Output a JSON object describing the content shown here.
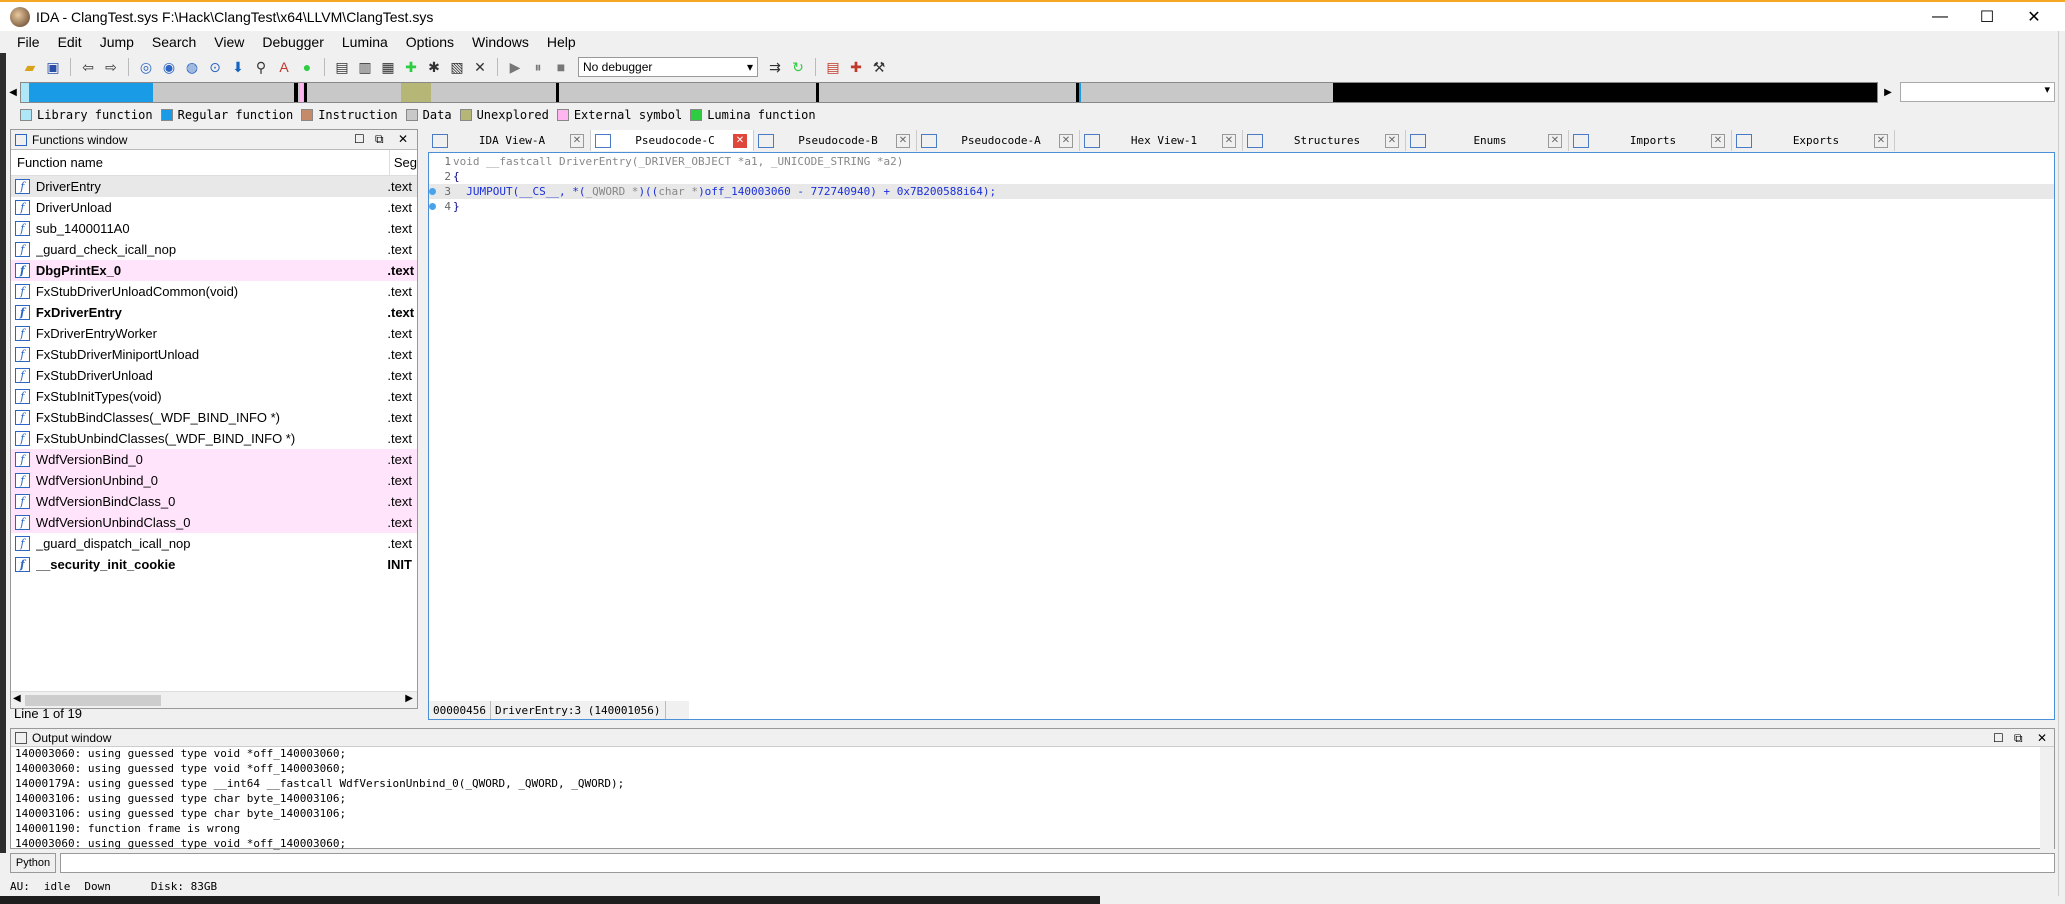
{
  "window": {
    "title": "IDA - ClangTest.sys F:\\Hack\\ClangTest\\x64\\LLVM\\ClangTest.sys",
    "minimize": "—",
    "maximize": "☐",
    "close": "✕"
  },
  "menu": [
    "File",
    "Edit",
    "Jump",
    "Search",
    "View",
    "Debugger",
    "Lumina",
    "Options",
    "Windows",
    "Help"
  ],
  "toolbar": {
    "debugger": "No debugger"
  },
  "legend": [
    {
      "label": "Library function",
      "color": "#aee8f8"
    },
    {
      "label": "Regular function",
      "color": "#1a9be6"
    },
    {
      "label": "Instruction",
      "color": "#c48a6a"
    },
    {
      "label": "Data",
      "color": "#c8c8c8"
    },
    {
      "label": "Unexplored",
      "color": "#b6b676"
    },
    {
      "label": "External symbol",
      "color": "#ffb6f0"
    },
    {
      "label": "Lumina function",
      "color": "#2ecc40"
    }
  ],
  "functions": {
    "title": "Functions window",
    "col_name": "Function name",
    "col_seg": "Seg",
    "rows": [
      {
        "name": "DriverEntry",
        "seg": ".text",
        "style": "sel"
      },
      {
        "name": "DriverUnload",
        "seg": ".text",
        "style": ""
      },
      {
        "name": "sub_1400011A0",
        "seg": ".text",
        "style": ""
      },
      {
        "name": "_guard_check_icall_nop",
        "seg": ".text",
        "style": ""
      },
      {
        "name": "DbgPrintEx_0",
        "seg": ".text",
        "style": "pink bold"
      },
      {
        "name": "FxStubDriverUnloadCommon(void)",
        "seg": ".text",
        "style": ""
      },
      {
        "name": "FxDriverEntry",
        "seg": ".text",
        "style": "bold"
      },
      {
        "name": "FxDriverEntryWorker",
        "seg": ".text",
        "style": ""
      },
      {
        "name": "FxStubDriverMiniportUnload",
        "seg": ".text",
        "style": ""
      },
      {
        "name": "FxStubDriverUnload",
        "seg": ".text",
        "style": ""
      },
      {
        "name": "FxStubInitTypes(void)",
        "seg": ".text",
        "style": ""
      },
      {
        "name": "FxStubBindClasses(_WDF_BIND_INFO *)",
        "seg": ".text",
        "style": ""
      },
      {
        "name": "FxStubUnbindClasses(_WDF_BIND_INFO *)",
        "seg": ".text",
        "style": ""
      },
      {
        "name": "WdfVersionBind_0",
        "seg": ".text",
        "style": "pink"
      },
      {
        "name": "WdfVersionUnbind_0",
        "seg": ".text",
        "style": "pink"
      },
      {
        "name": "WdfVersionBindClass_0",
        "seg": ".text",
        "style": "pink"
      },
      {
        "name": "WdfVersionUnbindClass_0",
        "seg": ".text",
        "style": "pink"
      },
      {
        "name": "_guard_dispatch_icall_nop",
        "seg": ".text",
        "style": ""
      },
      {
        "name": "__security_init_cookie",
        "seg": "INIT",
        "style": "bold"
      }
    ],
    "status": "Line 1 of 19"
  },
  "tabs": [
    {
      "label": "IDA View-A",
      "active": false
    },
    {
      "label": "Pseudocode-C",
      "active": true
    },
    {
      "label": "Pseudocode-B",
      "active": false
    },
    {
      "label": "Pseudocode-A",
      "active": false
    },
    {
      "label": "Hex View-1",
      "active": false
    },
    {
      "label": "Structures",
      "active": false
    },
    {
      "label": "Enums",
      "active": false
    },
    {
      "label": "Imports",
      "active": false
    },
    {
      "label": "Exports",
      "active": false
    }
  ],
  "code": {
    "line1": "void __fastcall DriverEntry(_DRIVER_OBJECT *a1, _UNICODE_STRING *a2)",
    "line2": "{",
    "line3_a": "  JUMPOUT(__CS__, *(",
    "line3_b": "_QWORD *",
    "line3_c": ")((",
    "line3_d": "char *",
    "line3_e": ")off_140003060 - 772740940) + 0x7B200588i64);",
    "line4": "}",
    "ln1": "1",
    "ln2": "2",
    "ln3": "3",
    "ln4": "4",
    "status_addr": "00000456",
    "status_loc": "DriverEntry:3 (140001056)"
  },
  "output": {
    "title": "Output window",
    "lines": [
      "140003060: using guessed type void *off_140003060;",
      "140003060: using guessed type void *off_140003060;",
      "14000179A: using guessed type __int64 __fastcall WdfVersionUnbind_0(_QWORD, _QWORD, _QWORD);",
      "140003106: using guessed type char byte_140003106;",
      "140003106: using guessed type char byte_140003106;",
      "140001190: function frame is wrong",
      "140003060: using guessed type void *off_140003060;"
    ]
  },
  "python_btn": "Python",
  "status": {
    "au": "AU:",
    "state": "idle",
    "dir": "Down",
    "disk": "Disk: 83GB"
  }
}
